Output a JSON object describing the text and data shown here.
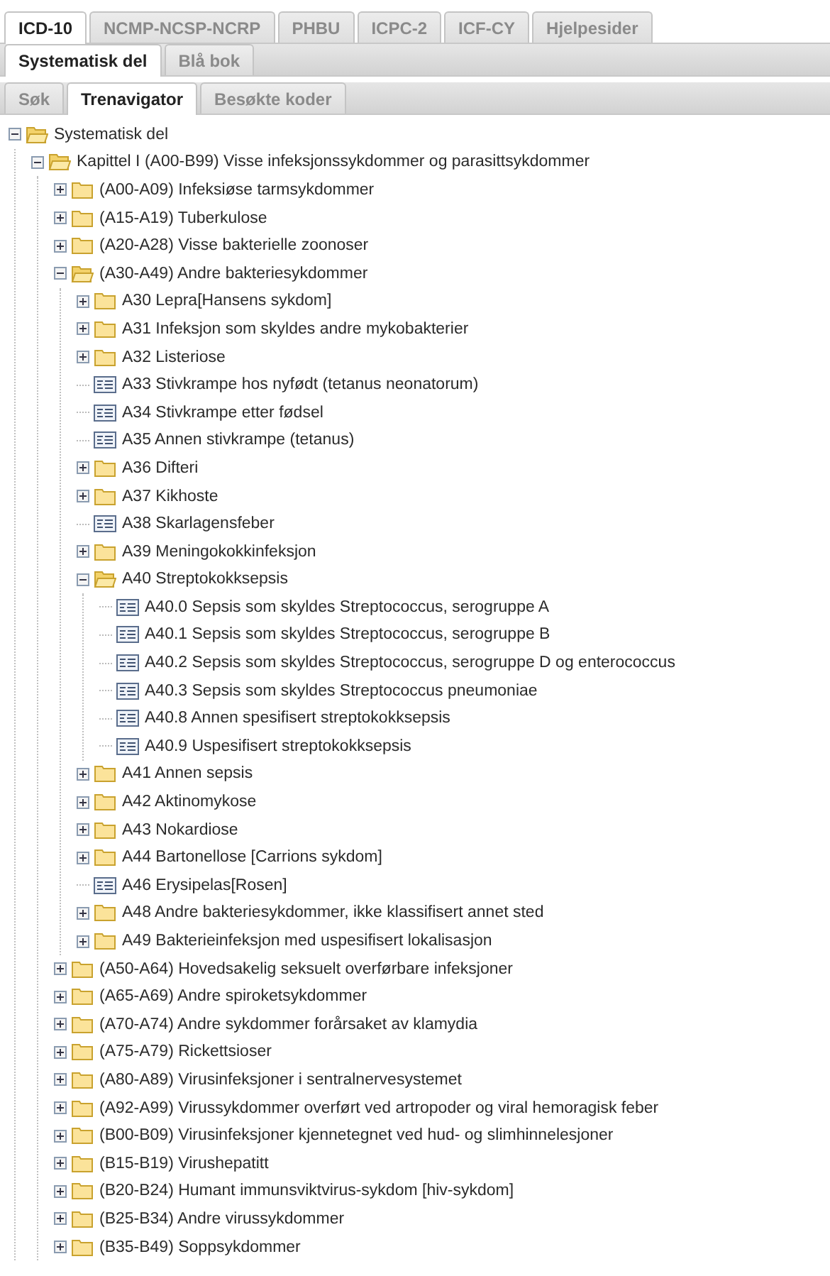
{
  "tabs_main": [
    {
      "label": "ICD-10",
      "selected": true
    },
    {
      "label": "NCMP-NCSP-NCRP",
      "selected": false
    },
    {
      "label": "PHBU",
      "selected": false
    },
    {
      "label": "ICPC-2",
      "selected": false
    },
    {
      "label": "ICF-CY",
      "selected": false
    },
    {
      "label": "Hjelpesider",
      "selected": false
    }
  ],
  "tabs_sub": [
    {
      "label": "Systematisk del",
      "selected": true
    },
    {
      "label": "Blå bok",
      "selected": false
    }
  ],
  "tabs_nav": [
    {
      "label": "Søk",
      "selected": false
    },
    {
      "label": "Trenavigator",
      "selected": true
    },
    {
      "label": "Besøkte koder",
      "selected": false
    }
  ],
  "tree": [
    {
      "kind": "folder",
      "label": "Systematisk del",
      "expanded": true,
      "children": [
        {
          "kind": "folder",
          "label": "Kapittel I (A00-B99) Visse infeksjonssykdommer og parasittsykdommer",
          "expanded": true,
          "children": [
            {
              "kind": "folder",
              "label": "(A00-A09) Infeksiøse tarmsykdommer",
              "expanded": false
            },
            {
              "kind": "folder",
              "label": "(A15-A19) Tuberkulose",
              "expanded": false
            },
            {
              "kind": "folder",
              "label": "(A20-A28) Visse bakterielle zoonoser",
              "expanded": false
            },
            {
              "kind": "folder",
              "label": "(A30-A49) Andre bakteriesykdommer",
              "expanded": true,
              "children": [
                {
                  "kind": "folder",
                  "label": "A30 Lepra[Hansens sykdom]",
                  "expanded": false
                },
                {
                  "kind": "folder",
                  "label": "A31 Infeksjon som skyldes andre mykobakterier",
                  "expanded": false
                },
                {
                  "kind": "folder",
                  "label": "A32 Listeriose",
                  "expanded": false
                },
                {
                  "kind": "leaf",
                  "label": "A33 Stivkrampe hos nyfødt (tetanus neonatorum)"
                },
                {
                  "kind": "leaf",
                  "label": "A34 Stivkrampe etter fødsel"
                },
                {
                  "kind": "leaf",
                  "label": "A35 Annen stivkrampe (tetanus)"
                },
                {
                  "kind": "folder",
                  "label": "A36 Difteri",
                  "expanded": false
                },
                {
                  "kind": "folder",
                  "label": "A37 Kikhoste",
                  "expanded": false
                },
                {
                  "kind": "leaf",
                  "label": "A38 Skarlagensfeber"
                },
                {
                  "kind": "folder",
                  "label": "A39 Meningokokkinfeksjon",
                  "expanded": false
                },
                {
                  "kind": "folder",
                  "label": "A40 Streptokokksepsis",
                  "expanded": true,
                  "children": [
                    {
                      "kind": "leaf",
                      "label": "A40.0 Sepsis som skyldes Streptococcus, serogruppe A"
                    },
                    {
                      "kind": "leaf",
                      "label": "A40.1 Sepsis som skyldes Streptococcus, serogruppe B"
                    },
                    {
                      "kind": "leaf",
                      "label": "A40.2 Sepsis som skyldes Streptococcus, serogruppe D og enterococcus"
                    },
                    {
                      "kind": "leaf",
                      "label": "A40.3 Sepsis som skyldes Streptococcus pneumoniae"
                    },
                    {
                      "kind": "leaf",
                      "label": "A40.8 Annen spesifisert streptokokksepsis"
                    },
                    {
                      "kind": "leaf",
                      "label": "A40.9 Uspesifisert streptokokksepsis"
                    }
                  ]
                },
                {
                  "kind": "folder",
                  "label": "A41 Annen sepsis",
                  "expanded": false
                },
                {
                  "kind": "folder",
                  "label": "A42 Aktinomykose",
                  "expanded": false
                },
                {
                  "kind": "folder",
                  "label": "A43 Nokardiose",
                  "expanded": false
                },
                {
                  "kind": "folder",
                  "label": "A44 Bartonellose [Carrions sykdom]",
                  "expanded": false
                },
                {
                  "kind": "leaf",
                  "label": "A46 Erysipelas[Rosen]"
                },
                {
                  "kind": "folder",
                  "label": "A48 Andre bakteriesykdommer, ikke klassifisert annet sted",
                  "expanded": false
                },
                {
                  "kind": "folder",
                  "label": "A49 Bakterieinfeksjon med uspesifisert lokalisasjon",
                  "expanded": false
                }
              ]
            },
            {
              "kind": "folder",
              "label": "(A50-A64) Hovedsakelig seksuelt overførbare infeksjoner",
              "expanded": false
            },
            {
              "kind": "folder",
              "label": "(A65-A69) Andre spiroketsykdommer",
              "expanded": false
            },
            {
              "kind": "folder",
              "label": "(A70-A74) Andre sykdommer forårsaket av klamydia",
              "expanded": false
            },
            {
              "kind": "folder",
              "label": "(A75-A79) Rickettsioser",
              "expanded": false
            },
            {
              "kind": "folder",
              "label": "(A80-A89) Virusinfeksjoner i sentralnervesystemet",
              "expanded": false
            },
            {
              "kind": "folder",
              "label": "(A92-A99) Virussykdommer overført ved artropoder og viral hemoragisk feber",
              "expanded": false
            },
            {
              "kind": "folder",
              "label": "(B00-B09) Virusinfeksjoner kjennetegnet ved hud- og slimhinnelesjoner",
              "expanded": false
            },
            {
              "kind": "folder",
              "label": "(B15-B19) Virushepatitt",
              "expanded": false
            },
            {
              "kind": "folder",
              "label": "(B20-B24) Humant immunsviktvirus-sykdom [hiv-sykdom]",
              "expanded": false
            },
            {
              "kind": "folder",
              "label": "(B25-B34) Andre virussykdommer",
              "expanded": false
            },
            {
              "kind": "folder",
              "label": "(B35-B49) Soppsykdommer",
              "expanded": false
            }
          ]
        }
      ]
    }
  ]
}
